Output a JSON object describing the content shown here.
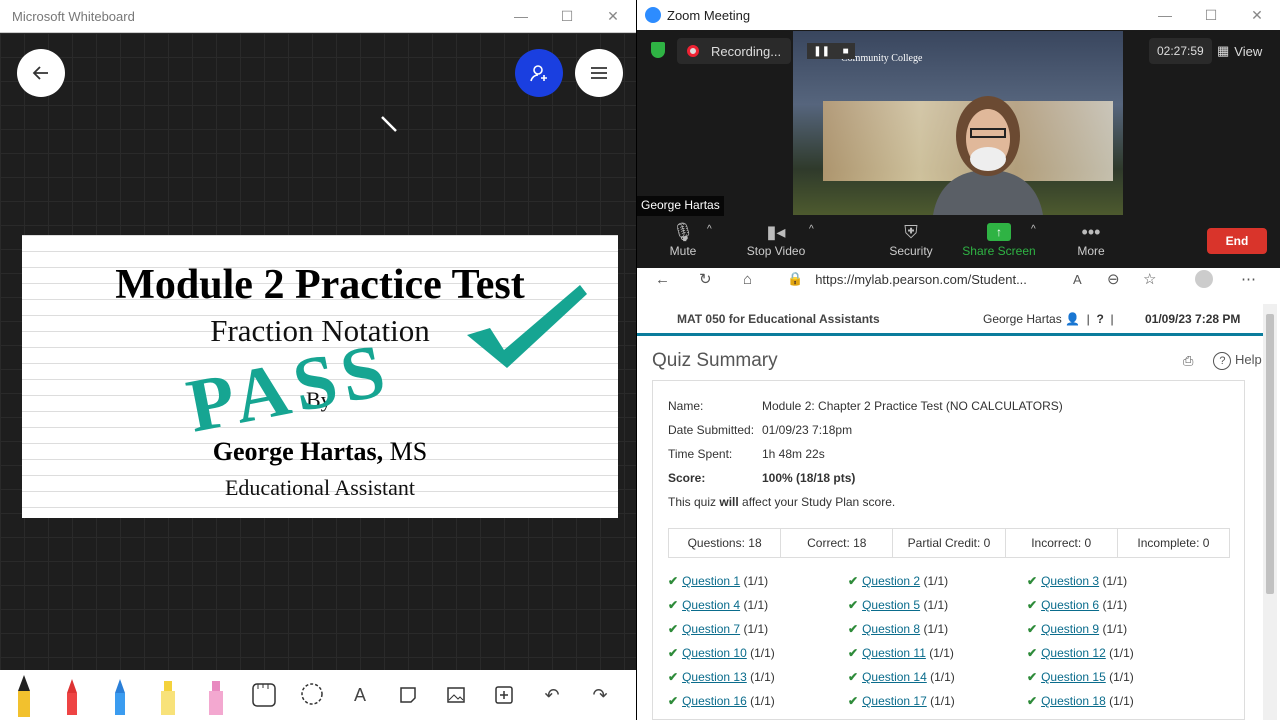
{
  "whiteboard": {
    "title": "Microsoft Whiteboard",
    "slide": {
      "title": "Module 2 Practice Test",
      "subtitle": "Fraction Notation",
      "by": "By",
      "author": "George Hartas,",
      "author_suffix": "MS",
      "role": "Educational Assistant",
      "stamp": "PASS"
    },
    "tools": [
      "pen-black",
      "pen-red",
      "pen-blue",
      "highlighter-yellow",
      "highlighter-pink",
      "eraser",
      "lasso",
      "text",
      "shape",
      "image",
      "insert",
      "undo",
      "redo"
    ]
  },
  "zoom": {
    "title": "Zoom Meeting",
    "recording_label": "Recording...",
    "timer": "02:27:59",
    "view_label": "View",
    "participant_name": "George Hartas",
    "video_overlay": "Community College",
    "controls": {
      "mute": "Mute",
      "stop_video": "Stop Video",
      "security": "Security",
      "share_screen": "Share Screen",
      "more": "More",
      "end": "End"
    },
    "share_color": "#2fb344"
  },
  "browser": {
    "url": "https://mylab.pearson.com/Student...",
    "course": "MAT 050 for Educational Assistants",
    "user": "George Hartas",
    "help_icon": "?",
    "datetime": "01/09/23 7:28 PM",
    "quiz": {
      "title": "Quiz Summary",
      "help": "Help",
      "name_label": "Name:",
      "name": "Module 2: Chapter 2 Practice Test (NO CALCULATORS)",
      "date_label": "Date Submitted:",
      "date": "01/09/23 7:18pm",
      "time_label": "Time Spent:",
      "time": "1h 48m 22s",
      "score_label": "Score:",
      "score": "100% (18/18 pts)",
      "note_pre": "This quiz ",
      "note_bold": "will",
      "note_post": " affect your Study Plan score.",
      "stats": [
        "Questions: 18",
        "Correct: 18",
        "Partial Credit: 0",
        "Incorrect: 0",
        "Incomplete: 0"
      ],
      "questions": [
        {
          "label": "Question 1",
          "score": "(1/1)"
        },
        {
          "label": "Question 2",
          "score": "(1/1)"
        },
        {
          "label": "Question 3",
          "score": "(1/1)"
        },
        {
          "label": "Question 4",
          "score": "(1/1)"
        },
        {
          "label": "Question 5",
          "score": "(1/1)"
        },
        {
          "label": "Question 6",
          "score": "(1/1)"
        },
        {
          "label": "Question 7",
          "score": "(1/1)"
        },
        {
          "label": "Question 8",
          "score": "(1/1)"
        },
        {
          "label": "Question 9",
          "score": "(1/1)"
        },
        {
          "label": "Question 10",
          "score": "(1/1)"
        },
        {
          "label": "Question 11",
          "score": "(1/1)"
        },
        {
          "label": "Question 12",
          "score": "(1/1)"
        },
        {
          "label": "Question 13",
          "score": "(1/1)"
        },
        {
          "label": "Question 14",
          "score": "(1/1)"
        },
        {
          "label": "Question 15",
          "score": "(1/1)"
        },
        {
          "label": "Question 16",
          "score": "(1/1)"
        },
        {
          "label": "Question 17",
          "score": "(1/1)"
        },
        {
          "label": "Question 18",
          "score": "(1/1)"
        }
      ]
    }
  }
}
